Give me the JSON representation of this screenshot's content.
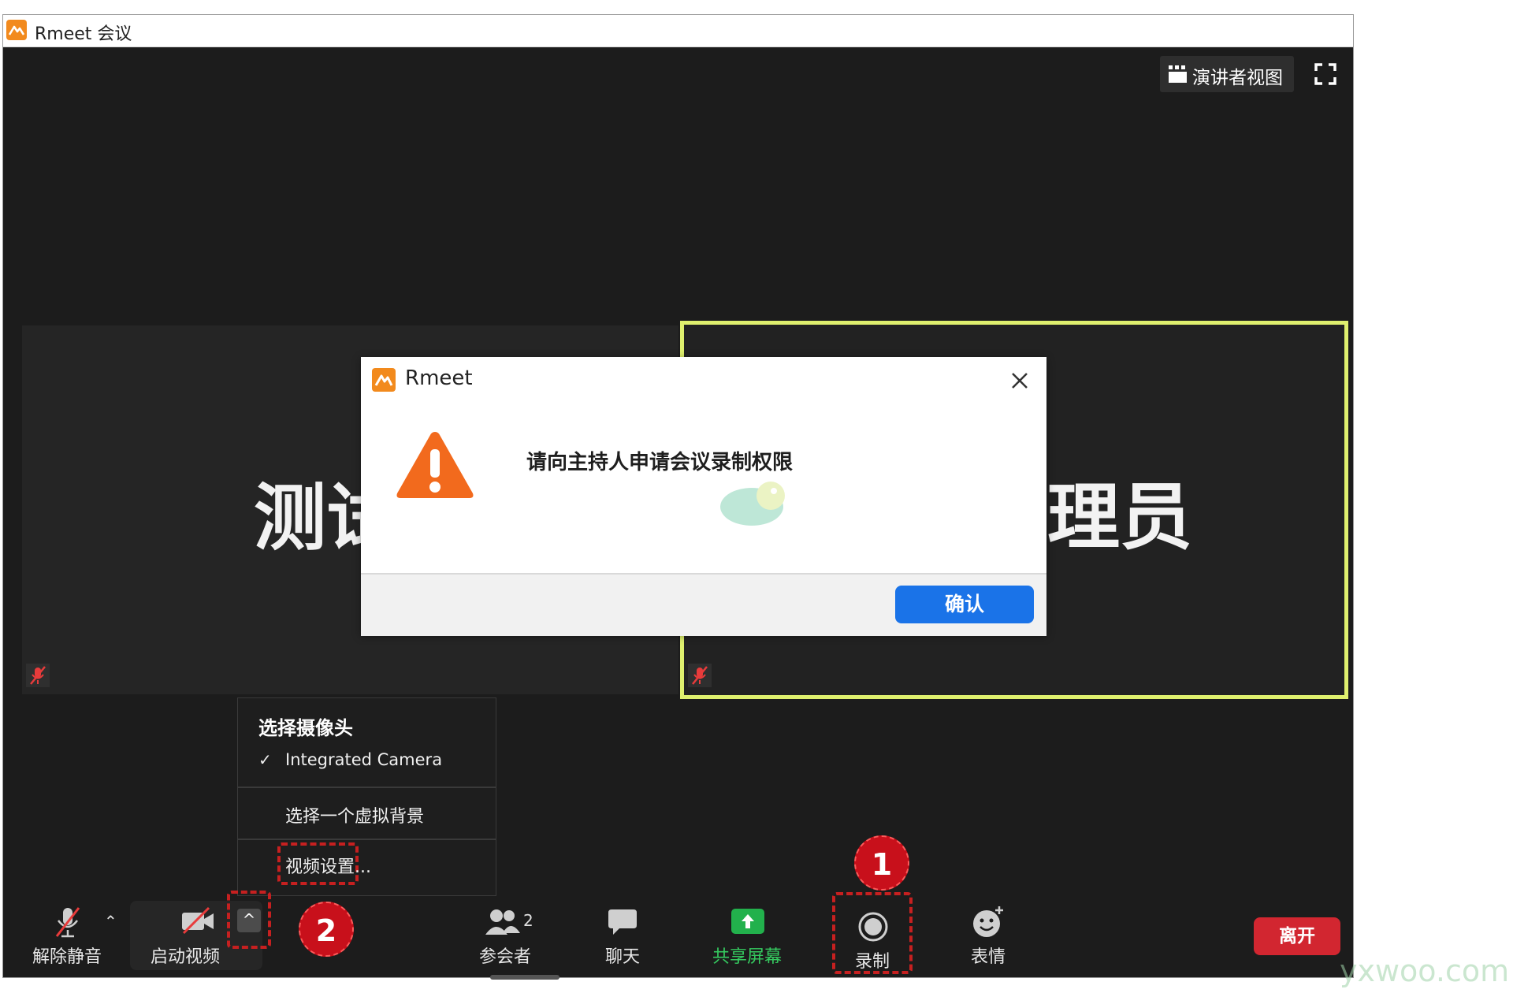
{
  "window": {
    "title": "Rmeet 会议"
  },
  "top_controls": {
    "speaker_view_label": "演讲者视图"
  },
  "tiles": {
    "left_name_partial": "测试",
    "right_name_partial": "理员"
  },
  "dialog": {
    "title": "Rmeet",
    "message": "请向主持人申请会议录制权限",
    "confirm_label": "确认"
  },
  "camera_menu": {
    "heading": "选择摄像头",
    "selected_camera": "Integrated Camera",
    "virtual_background": "选择一个虚拟背景",
    "video_settings": "视频设置..."
  },
  "toolbar": {
    "unmute": "解除静音",
    "start_video": "启动视频",
    "participants": "参会者",
    "participants_count": "2",
    "chat": "聊天",
    "share_screen": "共享屏幕",
    "record": "录制",
    "reactions": "表情",
    "leave": "离开"
  },
  "annotations": {
    "step1": "1",
    "step2": "2"
  },
  "watermark": "yxwoo.com",
  "colors": {
    "brand_orange": "#f28a1d",
    "active_speaker_border": "#dff06e",
    "primary_button": "#1a73e8",
    "leave_button": "#d22630",
    "share_green": "#22b14c",
    "annotation_red": "#c8101b"
  }
}
